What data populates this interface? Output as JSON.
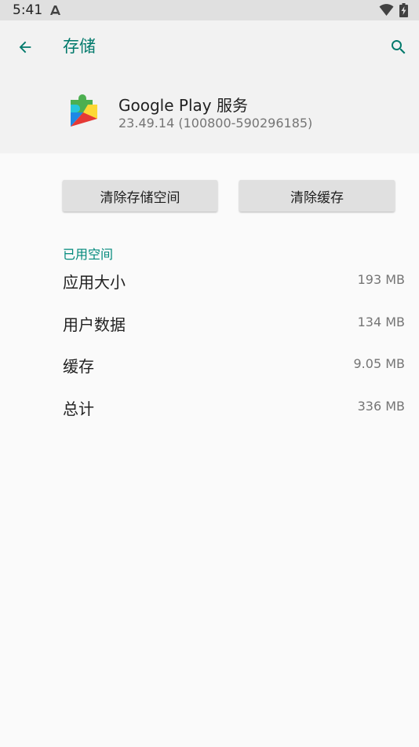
{
  "status_bar": {
    "time": "5:41",
    "icons": [
      "notification-a-icon",
      "wifi-icon",
      "battery-icon"
    ]
  },
  "toolbar": {
    "title": "存储",
    "back_icon": "arrow-back-icon",
    "search_icon": "search-icon"
  },
  "app": {
    "name": "Google Play 服务",
    "version": "23.49.14 (100800-590296185)",
    "icon": "google-play-services-icon"
  },
  "actions": {
    "clear_storage_label": "清除存储空间",
    "clear_cache_label": "清除缓存"
  },
  "storage": {
    "section_title": "已用空间",
    "rows": [
      {
        "label": "应用大小",
        "value": "193 MB"
      },
      {
        "label": "用户数据",
        "value": "134 MB"
      },
      {
        "label": "缓存",
        "value": "9.05 MB"
      },
      {
        "label": "总计",
        "value": "336 MB"
      }
    ]
  },
  "colors": {
    "accent": "#00796b",
    "header_bg": "#f2f2f2",
    "status_bar_bg": "#e0e0e0"
  }
}
